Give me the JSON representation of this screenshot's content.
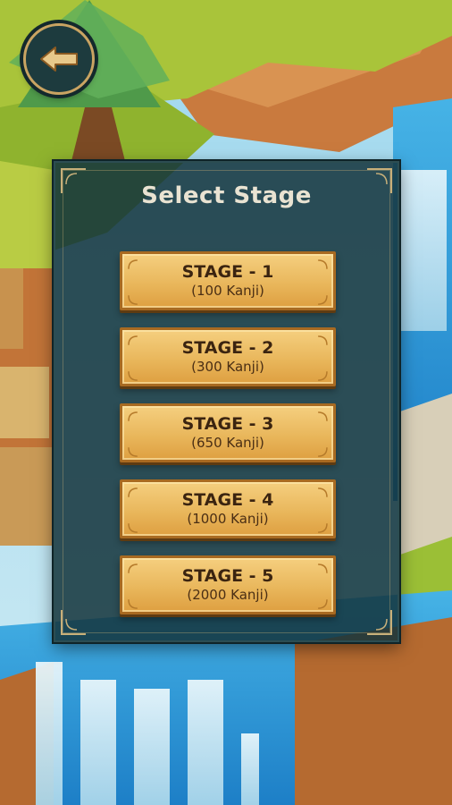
{
  "screen": {
    "title": "Select Stage",
    "back_icon": "arrow-left-icon"
  },
  "stages": [
    {
      "label": "STAGE - 1",
      "detail": "(100 Kanji)"
    },
    {
      "label": "STAGE - 2",
      "detail": "(300 Kanji)"
    },
    {
      "label": "STAGE - 3",
      "detail": "(650 Kanji)"
    },
    {
      "label": "STAGE - 4",
      "detail": "(1000 Kanji)"
    },
    {
      "label": "STAGE - 5",
      "detail": "(2000 Kanji)"
    }
  ],
  "colors": {
    "panel": "#14343c",
    "button_gold": "#e9b75c",
    "button_text": "#3b2410",
    "title_text": "#e9e3d2"
  }
}
